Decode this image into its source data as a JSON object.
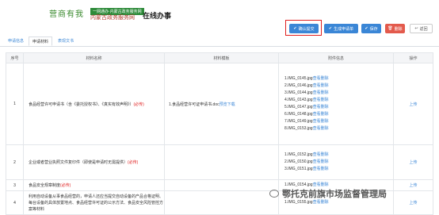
{
  "header": {
    "logo_text": "营商有我",
    "logo_sub": "一网通办·内蒙古政务服务网",
    "logo_name": "内蒙古政务服务网",
    "page_title": "在线办事"
  },
  "toolbar": {
    "confirm": "确认提交",
    "generate": "生成申请单",
    "save": "保存",
    "delete": "删除",
    "back": "返回"
  },
  "tabs": [
    "申请信息",
    "申请材料",
    "表现文书"
  ],
  "table": {
    "headers": [
      "序号",
      "材料名称",
      "材料模板",
      "附件信息",
      "操作"
    ],
    "rows": [
      {
        "idx": "1",
        "name": "食品经营许可申请书（含《委托授权书》、《真实有效声明》）",
        "required": "(必传)",
        "template": "1.食品经营许可证申请书.doc",
        "template_link": "预览下载",
        "files": [
          {
            "name": "1.IMG_0145.jpg",
            "links": "查看删除"
          },
          {
            "name": "2.IMG_0146.jpg",
            "links": "查看删除"
          },
          {
            "name": "3.IMG_0144.jpg",
            "links": "查看删除"
          },
          {
            "name": "4.IMG_0143.jpg",
            "links": "查看删除"
          },
          {
            "name": "5.IMG_0147.jpg",
            "links": "查看删除"
          },
          {
            "name": "6.IMG_0148.jpg",
            "links": "查看删除"
          },
          {
            "name": "7.IMG_0149.jpg",
            "links": "查看删除"
          },
          {
            "name": "8.IMG_0153.jpg",
            "links": "查看删除"
          }
        ],
        "op": "上传"
      },
      {
        "idx": "2",
        "name": "企业或者营业执照文件复印件（即使是申请时无需提供）",
        "required": "(必传)",
        "template": "",
        "files": [
          {
            "name": "1.IMG_0152.jpg",
            "links": "查看删除"
          },
          {
            "name": "2.IMG_0150.jpg",
            "links": "查看删除"
          },
          {
            "name": "3.IMG_0151.jpg",
            "links": "查看删除"
          }
        ],
        "op": "上传"
      },
      {
        "idx": "3",
        "name": "食品安全规章制度",
        "required": "(必传)",
        "template": "",
        "files": [
          {
            "name": "1.IMG_0154.jpg",
            "links": "查看删除"
          }
        ],
        "op": "上传"
      },
      {
        "idx": "4",
        "name": "利用自动设备从事食品经营的，申请人还应当提交自动设备的产品合格证明、每台设备的具体放置地点、食品经营许可证的公示方法、食品安全风险管控方案等材料",
        "required": "",
        "template": "",
        "files": [
          {
            "name": "1.IMG_0155.jpg",
            "links": "查看删除"
          }
        ],
        "op": "上传"
      }
    ]
  },
  "watermark": "鄂托克前旗市场监督管理局"
}
